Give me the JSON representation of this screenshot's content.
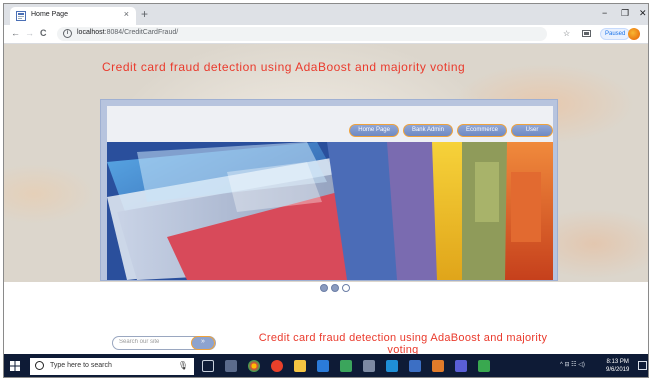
{
  "browser": {
    "tab_title": "Home Page",
    "tab_close": "×",
    "new_tab": "+",
    "window_controls": {
      "minimize": "−",
      "maximize": "❐",
      "close": "✕"
    },
    "back": "←",
    "forward": "→",
    "reload": "C",
    "info": "i",
    "url_host": "localhost",
    "url_rest": ":8084/CreditCardFraud/",
    "star": "☆",
    "paused_label": "Paused",
    "menu": "⋮"
  },
  "page": {
    "hero_title": "Credit card fraud detection using AdaBoost and majority voting",
    "nav_items": [
      "Home Page",
      "Bank Admin",
      "Ecommerce",
      "User"
    ],
    "search_placeholder": "Search our site",
    "footer_title": "Credit card fraud detection using AdaBoost and majority voting"
  },
  "taskbar": {
    "search_text": "Type here to search",
    "mic": "🎙",
    "tray": "^  ⊟  ☷  ◁)",
    "clock_time": "8:13 PM",
    "clock_date": "9/6/2019"
  },
  "colors": {
    "accent_red": "#ea3a2c",
    "nav_blue": "#7b93c8",
    "nav_border": "#f0a23a",
    "taskbar": "#0e1b36"
  }
}
